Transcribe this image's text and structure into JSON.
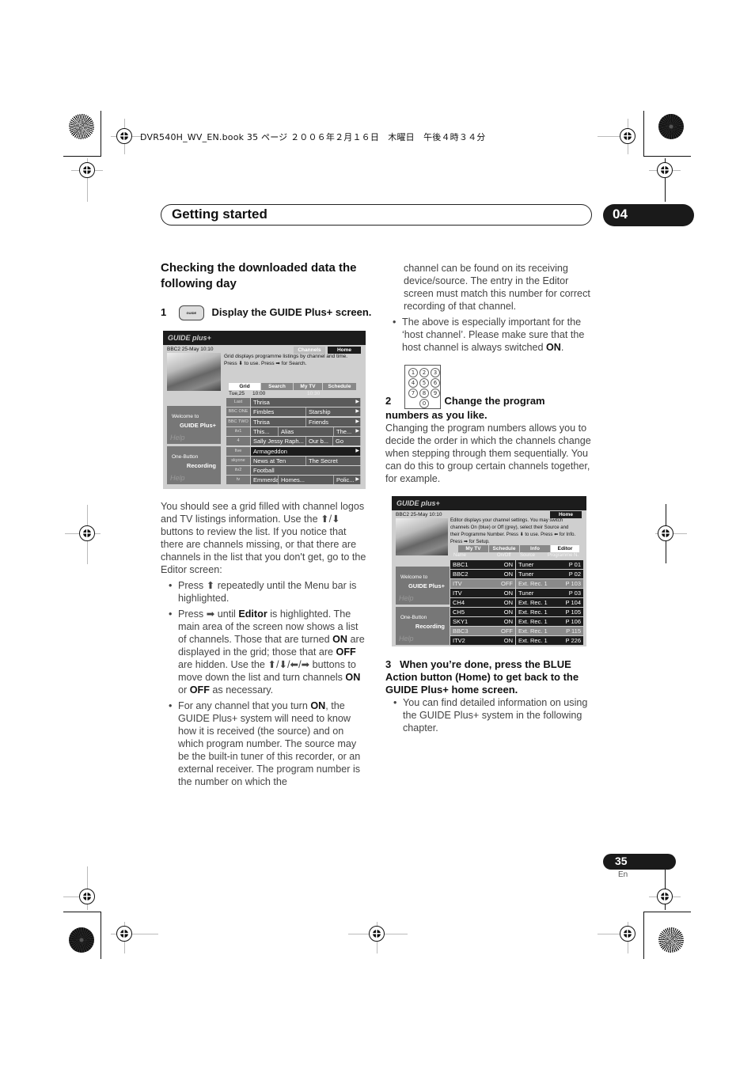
{
  "print_header": "DVR540H_WV_EN.book  35 ページ  ２００６年２月１６日　木曜日　午後４時３４分",
  "title_bar": {
    "title": "Getting started",
    "chapter": "04"
  },
  "section": {
    "heading": "Checking the downloaded data the following day",
    "step1": {
      "number": "1",
      "button_icon_label": "GUIDE",
      "text": "Display the GUIDE Plus+ screen."
    },
    "paragraph1": "You should see a grid filled with channel logos and TV listings information. Use the ⬆/⬇ buttons to review the list. If you notice that there are channels missing, or that there are channels in the list that you don't get, go to the Editor screen:",
    "bullets1": [
      {
        "parts": [
          "Press ⬆ repeatedly until the Menu bar is highlighted."
        ]
      },
      {
        "pre": "Press ➡ until ",
        "bold1": "Editor",
        "mid": " is highlighted. The main area of the screen now shows a list of channels. Those that are turned ",
        "bold2": "ON",
        "mid2": " are displayed in the grid; those that are ",
        "bold3": "OFF",
        "mid3": " are hidden. Use the ⬆/⬇/⬅/➡ buttons to move down the list and turn channels ",
        "bold4": "ON",
        "mid4": " or ",
        "bold5": "OFF",
        "post": " as necessary."
      },
      {
        "pre": "For any channel that you turn ",
        "bold1": "ON",
        "post": ", the GUIDE Plus+ system will need to know how it is received (the source) and on which program number. The source may be the built-in tuner of this recorder, or an external receiver. The program number is the number on which the channel can be found on its receiving device/source. The entry in the Editor screen must match this number for correct recording of that channel."
      },
      {
        "pre": "The above is especially important for the ‘host channel’. Please make sure that the host channel is always switched ",
        "bold1": "ON",
        "post": "."
      }
    ],
    "step2": {
      "number": "2",
      "text": "Change the program numbers as you like.",
      "body": "Changing the program numbers allows you to decide the order in which the channels change when stepping through them sequentially. You can do this to group certain channels together, for example.",
      "keypad": [
        "1",
        "2",
        "3",
        "4",
        "5",
        "6",
        "7",
        "8",
        "9",
        "0"
      ]
    },
    "step3": {
      "number": "3",
      "text": "When you’re done, press the BLUE Action button (Home) to get back to the GUIDE Plus+ home screen.",
      "bullet": "You can find detailed information on using the GUIDE Plus+ system in the following chapter."
    }
  },
  "screen1": {
    "logo": "GUIDE plus+",
    "status": "BBC2   25-May   10:10",
    "description": "Grid displays programme listings by channel and time. Press ⬇ to use. Press ➡ for Search.",
    "top_tabs": [
      "Channels",
      "Home"
    ],
    "tabs": [
      "Grid",
      "Search",
      "My TV",
      "Schedule"
    ],
    "date": "Tue,25",
    "times": [
      "10:00",
      "10:30"
    ],
    "side_panels": [
      {
        "line1": "Welcome to",
        "line2": "GUIDE Plus+",
        "help": "Help"
      },
      {
        "line1": "One-Button",
        "line2": "Recording",
        "help": "Help"
      }
    ],
    "rows": [
      {
        "channel": "Last Channel",
        "programmes": [
          "Thrisa"
        ],
        "highlight": false
      },
      {
        "channel": "BBC ONE",
        "programmes": [
          "Fimbles",
          "Starship"
        ],
        "highlight": false
      },
      {
        "channel": "BBC TWO",
        "programmes": [
          "Thrisa",
          "Friends"
        ],
        "highlight": false
      },
      {
        "channel": "itv1",
        "programmes": [
          "This...",
          "Alias",
          "The..."
        ],
        "highlight": false
      },
      {
        "channel": "4",
        "programmes": [
          "Sally Jessy Raph...",
          "Our b...",
          "Go"
        ],
        "highlight": false
      },
      {
        "channel": "five",
        "programmes": [
          "Armageddon"
        ],
        "highlight": true
      },
      {
        "channel": "skyone",
        "programmes": [
          "News at Ten",
          "The Secret"
        ],
        "highlight": false
      },
      {
        "channel": "itv2",
        "programmes": [
          "Football"
        ],
        "highlight": false
      },
      {
        "channel": "tv",
        "programmes": [
          "Emmerdale",
          "Homes...",
          "Polic..."
        ],
        "highlight": false
      }
    ]
  },
  "screen2": {
    "logo": "GUIDE plus+",
    "status": "BBC2   25-May   10:10",
    "home": "Home",
    "description": "Editor displays your channel settings. You may switch channels On (blue) or Off (grey), select their Source and their Programme Number. Press ⬇ to use. Press ⬅ for Info. Press ➡ for Setup.",
    "tabs": [
      "My TV",
      "Schedule",
      "Info",
      "Editor"
    ],
    "columns": [
      "Name",
      "On/Off",
      "Source",
      "Programme N."
    ],
    "side_panels": [
      {
        "line1": "Welcome to",
        "line2": "GUIDE Plus+",
        "help": "Help"
      },
      {
        "line1": "One-Button",
        "line2": "Recording",
        "help": "Help"
      }
    ],
    "rows": [
      {
        "name": "BBC1",
        "state": "ON",
        "source": "Tuner",
        "prog": "P  01"
      },
      {
        "name": "BBC2",
        "state": "ON",
        "source": "Tuner",
        "prog": "P  02"
      },
      {
        "name": "ITV",
        "state": "OFF",
        "source": "Ext. Rec. 1",
        "prog": "P 103"
      },
      {
        "name": "ITV",
        "state": "ON",
        "source": "Tuner",
        "prog": "P  03"
      },
      {
        "name": "CH4",
        "state": "ON",
        "source": "Ext. Rec. 1",
        "prog": "P 104"
      },
      {
        "name": "CH5",
        "state": "ON",
        "source": "Ext. Rec. 1",
        "prog": "P 105"
      },
      {
        "name": "SKY1",
        "state": "ON",
        "source": "Ext. Rec. 1",
        "prog": "P 106"
      },
      {
        "name": "BBC3",
        "state": "OFF",
        "source": "Ext. Rec. 1",
        "prog": "P 115"
      },
      {
        "name": "ITV2",
        "state": "ON",
        "source": "Ext. Rec. 1",
        "prog": "P 226"
      }
    ]
  },
  "footer": {
    "page": "35",
    "lang": "En"
  }
}
